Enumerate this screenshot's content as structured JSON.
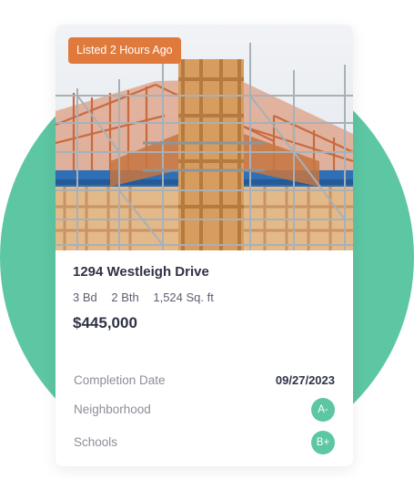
{
  "listing": {
    "badge": "Listed 2 Hours Ago",
    "address": "1294 Westleigh Drive",
    "beds": "3 Bd",
    "baths": "2 Bth",
    "area": "1,524 Sq. ft",
    "price": "$445,000"
  },
  "details": [
    {
      "label": "Completion Date",
      "value": "09/27/2023"
    },
    {
      "label": "Neighborhood",
      "grade": "A-"
    },
    {
      "label": "Schools",
      "grade": "B+"
    }
  ],
  "colors": {
    "accent_green": "#5dc6a3",
    "badge_orange": "#e07a3c",
    "text_dark": "#2f3245",
    "text_muted": "#8c8e99"
  },
  "photo": {
    "subject": "house-under-construction-with-scaffolding"
  }
}
